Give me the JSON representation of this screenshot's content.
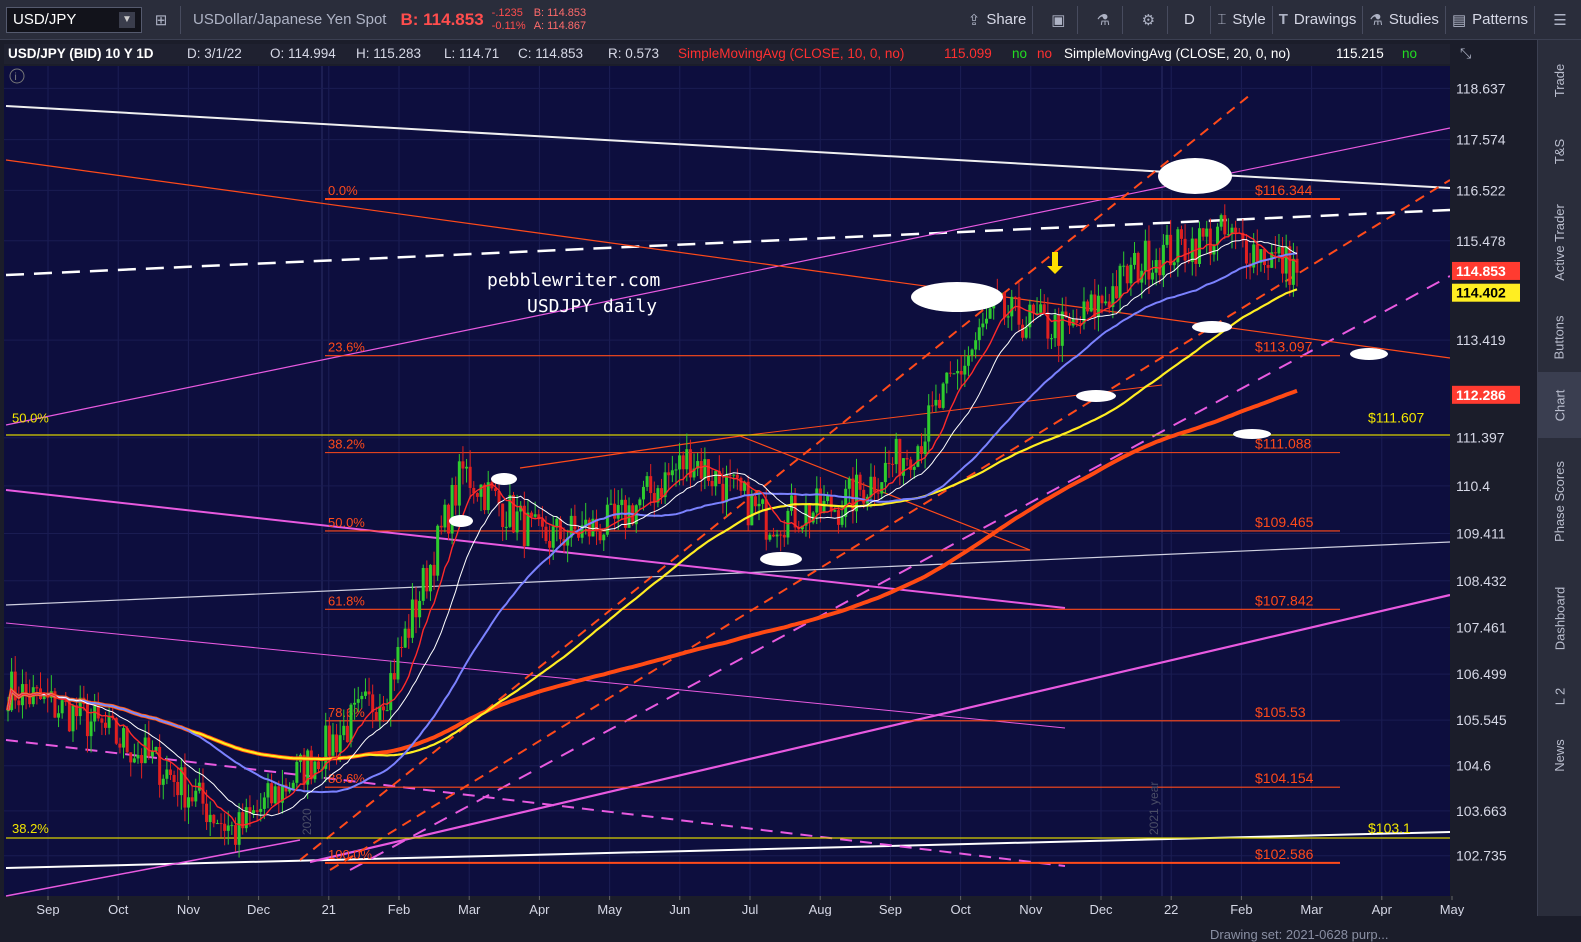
{
  "toolbar": {
    "symbol": "USD/JPY",
    "description": "USDollar/Japanese Yen Spot",
    "bid": "B: 114.853",
    "change": "-.1235",
    "change_pct": "-0.11%",
    "bid_small": "B: 114.853",
    "ask_small": "A: 114.867",
    "share": "Share",
    "period": "D",
    "style": "Style",
    "drawings": "Drawings",
    "studies": "Studies",
    "patterns": "Patterns"
  },
  "header": {
    "symbol": "USD/JPY (BID) 10 Y 1D",
    "date": "D: 3/1/22",
    "open": "O: 114.994",
    "high": "H: 115.283",
    "low": "L: 114.71",
    "close": "C: 114.853",
    "range": "R: 0.573",
    "sma10": "SimpleMovingAvg (CLOSE, 10, 0, no)",
    "sma10_val": "115.099",
    "no1": "no",
    "no2": "no",
    "sma20": "SimpleMovingAvg (CLOSE, 20, 0, no)",
    "sma20_val": "115.215",
    "no3": "no"
  },
  "sidebar": [
    "Trade",
    "T&S",
    "Active Trader",
    "Buttons",
    "Chart",
    "Phase Scores",
    "Dashboard",
    "L 2",
    "News"
  ],
  "status": "Drawing set: 2021-0628 purp...",
  "colors": {
    "bg": "#0d0e3e",
    "fib": "#ff4a1a",
    "sma10": "#ff2a2a",
    "sma20": "#ffffff",
    "sma50": "#7b82ff",
    "sma100": "#ffee22",
    "sma200": "#ff4a14",
    "magenta": "#e85ae0",
    "yellow_line": "#d8d000"
  },
  "chart_data": {
    "type": "candlestick",
    "title": "USDJPY daily",
    "watermark": "pebblewriter.com",
    "x_ticks": [
      "Sep",
      "Oct",
      "Nov",
      "Dec",
      "21",
      "Feb",
      "Mar",
      "Apr",
      "May",
      "Jun",
      "Jul",
      "Aug",
      "Sep",
      "Oct",
      "Nov",
      "Dec",
      "22",
      "Feb",
      "Mar",
      "Apr",
      "May"
    ],
    "year_markers": [
      "2020",
      "2021 year"
    ],
    "y_ticks": [
      118.637,
      117.574,
      116.522,
      115.478,
      113.419,
      111.397,
      110.4,
      109.411,
      108.432,
      107.461,
      106.499,
      105.545,
      104.6,
      103.663,
      102.735
    ],
    "ylim": [
      101.9,
      119.1
    ],
    "price_tags": [
      {
        "label": "114.853",
        "value": 114.853,
        "color": "#ff3b30"
      },
      {
        "label": "114.402",
        "value": 114.402,
        "color": "#ffee22"
      },
      {
        "label": "112.286",
        "value": 112.286,
        "color": "#ff3b30"
      }
    ],
    "fib_levels": [
      {
        "pct": "0.0%",
        "price": "$116.344",
        "value": 116.344
      },
      {
        "pct": "23.6%",
        "price": "$113.097",
        "value": 113.097
      },
      {
        "pct": "38.2%",
        "price": "$111.088",
        "value": 111.088
      },
      {
        "pct": "50.0%",
        "price": "$109.465",
        "value": 109.465
      },
      {
        "pct": "61.8%",
        "price": "$107.842",
        "value": 107.842
      },
      {
        "pct": "78.6%",
        "price": "$105.53",
        "value": 105.53
      },
      {
        "pct": "88.6%",
        "price": "$104.154",
        "value": 104.154
      },
      {
        "pct": "100.0%",
        "price": "$102.586",
        "value": 102.586
      }
    ],
    "yellow_levels": [
      {
        "pct": "50.0%",
        "price": "$111.607",
        "value": 111.607
      },
      {
        "pct": "38.2%",
        "price": "$103.1",
        "value": 103.1
      }
    ],
    "series": [
      {
        "month_closes": [
          106.2,
          105.6,
          104.6,
          103.2,
          104.7,
          106.2,
          110.7,
          109.3,
          109.6,
          111.0,
          109.7,
          110.0,
          111.3,
          114.0,
          113.6,
          115.1,
          115.6,
          114.9
        ]
      }
    ]
  }
}
